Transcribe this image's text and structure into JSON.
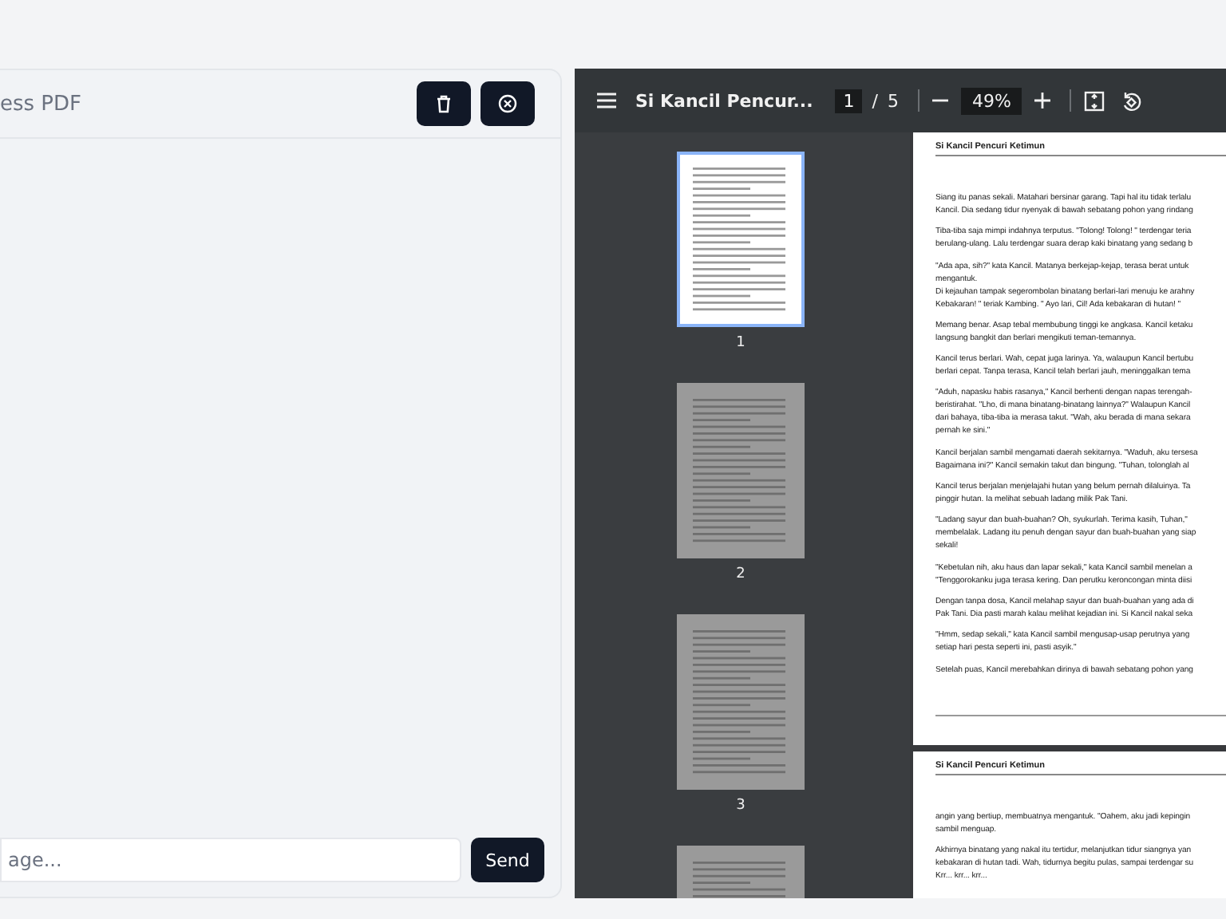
{
  "chat": {
    "title": "ess PDF",
    "input": {
      "placeholder": "age..."
    },
    "send_label": "Send"
  },
  "viewer": {
    "title": "Si Kancil Pencur...",
    "page_current": "1",
    "page_separator": "/",
    "page_total": "5",
    "zoom": "49%",
    "thumbnails": [
      {
        "label": "1",
        "selected": true
      },
      {
        "label": "2",
        "selected": false
      },
      {
        "label": "3",
        "selected": false
      },
      {
        "selected": false
      }
    ],
    "pages": [
      {
        "header": "Si Kancil Pencuri Ketimun",
        "paragraphs": [
          [
            "Siang itu panas sekali. Matahari bersinar garang. Tapi hal itu tidak terlalu",
            "Kancil. Dia sedang tidur nyenyak di bawah sebatang pohon yang rindang"
          ],
          [
            "Tiba-tiba saja mimpi indahnya terputus. \"Tolong! Tolong! \" terdengar teria",
            "berulang-ulang. Lalu terdengar suara derap kaki binatang yang sedang b"
          ],
          [
            "\"Ada apa, sih?\" kata Kancil. Matanya berkejap-kejap, terasa berat untuk",
            "mengantuk.",
            "Di kejauhan tampak segerombolan binatang berlari-lari menuju ke arahny",
            "Kebakaran! \" teriak Kambing. \" Ayo lari, Cil! Ada kebakaran di hutan! \""
          ],
          [
            "Memang benar. Asap tebal membubung tinggi ke angkasa. Kancil ketaku",
            "langsung bangkit dan berlari mengikuti teman-temannya."
          ],
          [
            "Kancil terus berlari. Wah, cepat juga larinya. Ya, walaupun Kancil bertubu",
            "berlari cepat. Tanpa terasa, Kancil telah berlari jauh, meninggalkan tema"
          ],
          [
            "\"Aduh, napasku habis rasanya,\" Kancil berhenti dengan napas terengah-",
            "beristirahat. \"Lho, di mana binatang-binatang lainnya?\" Walaupun Kancil",
            "dari bahaya, tiba-tiba ia merasa takut. \"Wah, aku berada di mana sekara",
            "pernah ke sini.\""
          ],
          [
            "Kancil berjalan sambil mengamati daerah sekitarnya. \"Waduh, aku tersesa",
            "Bagaimana ini?\" Kancil semakin takut dan bingung. \"Tuhan, tolonglah al"
          ],
          [
            "Kancil terus berjalan menjelajahi hutan yang belum pernah dilaluinya. Ta",
            "pinggir hutan. Ia melihat sebuah ladang milik Pak Tani."
          ],
          [
            "\"Ladang sayur dan buah-buahan? Oh, syukurlah. Terima kasih, Tuhan,\"",
            "membelalak. Ladang itu penuh dengan sayur dan buah-buahan yang siap",
            "sekali!"
          ],
          [
            "\"Kebetulan nih, aku haus dan lapar sekali,\" kata Kancil sambil menelan a",
            "\"Tenggorokanku juga terasa kering. Dan perutku keroncongan minta diisi"
          ],
          [
            "Dengan tanpa dosa, Kancil melahap sayur dan buah-buahan yang ada di",
            "Pak Tani. Dia pasti marah kalau melihat kejadian ini. Si Kancil nakal seka"
          ],
          [
            "\"Hmm, sedap sekali,\" kata Kancil sambil mengusap-usap perutnya yang",
            "setiap hari pesta seperti ini, pasti asyik.\""
          ],
          [
            "Setelah puas, Kancil merebahkan dirinya di bawah sebatang pohon yang"
          ]
        ]
      },
      {
        "header": "Si Kancil Pencuri Ketimun",
        "paragraphs": [
          [
            "angin yang bertiup, membuatnya mengantuk. \"Oahem, aku jadi kepingin",
            "sambil menguap."
          ],
          [
            "Akhirnya binatang yang nakal itu tertidur, melanjutkan tidur siangnya yan",
            "kebakaran di hutan tadi. Wah, tidurnya begitu pulas, sampai terdengar su",
            "Krr... krr... krr..."
          ]
        ]
      }
    ]
  }
}
